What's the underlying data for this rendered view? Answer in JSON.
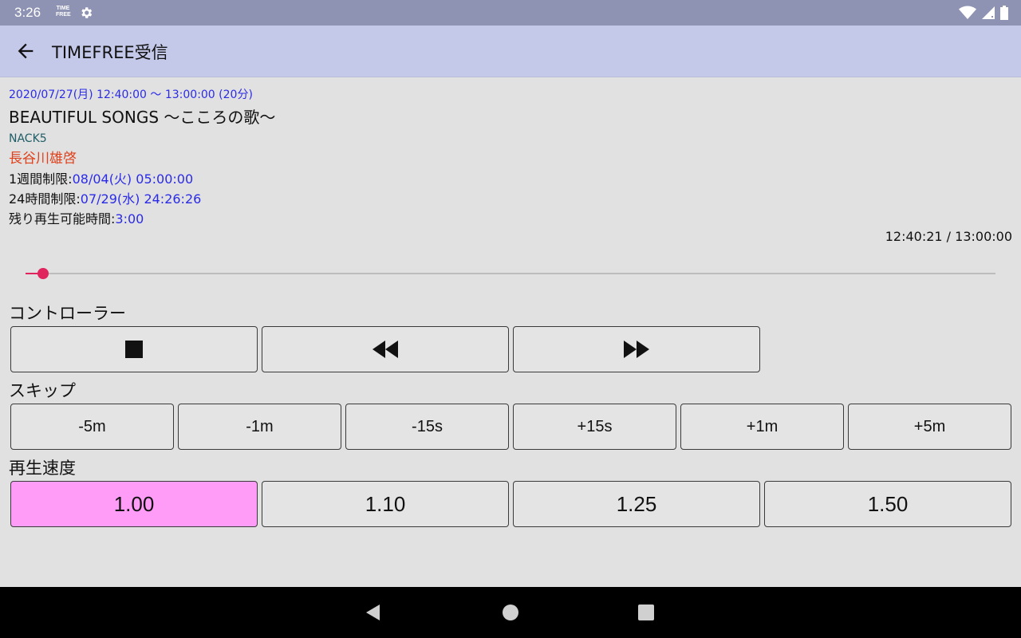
{
  "status_bar": {
    "time": "3:26",
    "app_badge": "TIME FREE"
  },
  "app_bar": {
    "title": "TIMEFREE受信"
  },
  "program": {
    "datetime": "2020/07/27(月) 12:40:00 〜 13:00:00 (20分)",
    "title": "BEAUTIFUL SONGS 〜こころの歌〜",
    "station": "NACK5",
    "personality": "長谷川雄啓",
    "week_limit_label": "1週間制限:",
    "week_limit_value": "08/04(火) 05:00:00",
    "day_limit_label": "24時間制限:",
    "day_limit_value": "07/29(水) 24:26:26",
    "remaining_label": "残り再生可能時間:",
    "remaining_value": "3:00"
  },
  "playback": {
    "position_text": "12:40:21 / 13:00:00",
    "progress_fraction": 0.018
  },
  "controller": {
    "heading": "コントローラー",
    "buttons": [
      "stop-icon",
      "rewind-icon",
      "fast-forward-icon"
    ]
  },
  "skip": {
    "heading": "スキップ",
    "buttons": [
      "-5m",
      "-1m",
      "-15s",
      "+15s",
      "+1m",
      "+5m"
    ]
  },
  "speed": {
    "heading": "再生速度",
    "options": [
      "1.00",
      "1.10",
      "1.25",
      "1.50"
    ],
    "selected": "1.00"
  },
  "colors": {
    "accent": "#e0245e",
    "selected_speed": "#ff9cf8",
    "app_bar": "#c5c9e9",
    "status_bar": "#8f93b3",
    "link_blue": "#2b2be6",
    "personality": "#e0401a"
  }
}
